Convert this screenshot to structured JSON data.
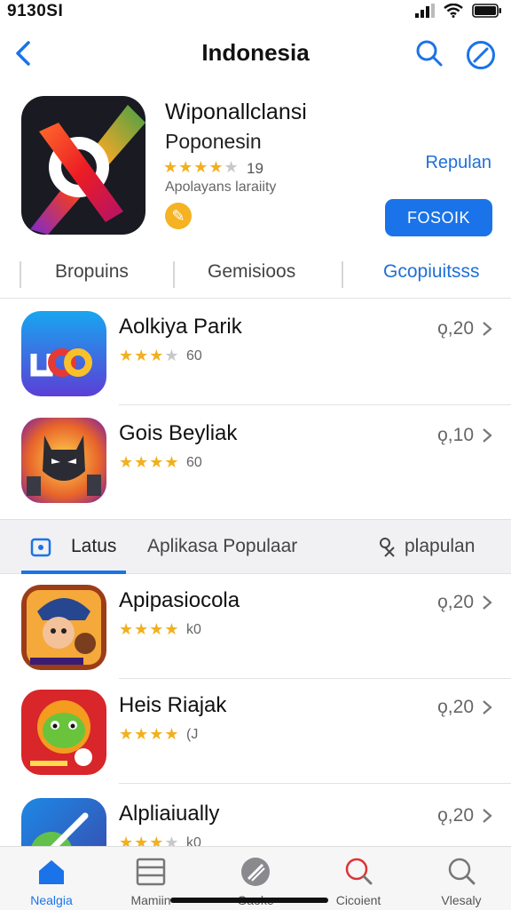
{
  "status": {
    "time": "9130SI"
  },
  "nav": {
    "title": "Indonesia"
  },
  "hero": {
    "name": "Wiponal​lclansi",
    "subtitle": "Poponesin",
    "rating_count": "19",
    "stars": 3.5,
    "description": "Apolayans laraiity",
    "link": "Repulan",
    "button": "FOSOIK"
  },
  "segments": [
    {
      "label": "Bropuins"
    },
    {
      "label": "Gemisioos"
    },
    {
      "label": "Gcopiuitsss"
    }
  ],
  "top_list": [
    {
      "name": "Aolkiya Parik",
      "stars": 3.5,
      "rating_count": "60",
      "price": "ǫ,20"
    },
    {
      "name": "Gois Beyliak",
      "stars": 4,
      "rating_count": "60",
      "price": "ǫ,10"
    }
  ],
  "secondary_tabs": [
    {
      "label": "Latus"
    },
    {
      "label": "Aplikasa Populaar"
    },
    {
      "label": "plapulan"
    }
  ],
  "bottom_list": [
    {
      "name": "Apipasiocola",
      "stars": 4,
      "rating_count": "k0",
      "price": "ǫ,20"
    },
    {
      "name": "Heis Riajak",
      "stars": 4,
      "rating_count": "(J",
      "price": "ǫ,20"
    },
    {
      "name": "Alpliaiually",
      "stars": 3.5,
      "rating_count": "k0",
      "price": "ǫ,20"
    }
  ],
  "bottom_tabs": [
    {
      "label": "Nealgia"
    },
    {
      "label": "Mamiin"
    },
    {
      "label": "Gaoke"
    },
    {
      "label": "Cicoient"
    },
    {
      "label": "Vlesaly"
    }
  ],
  "colors": {
    "accent": "#1a73e8",
    "star": "#f2b01e"
  }
}
